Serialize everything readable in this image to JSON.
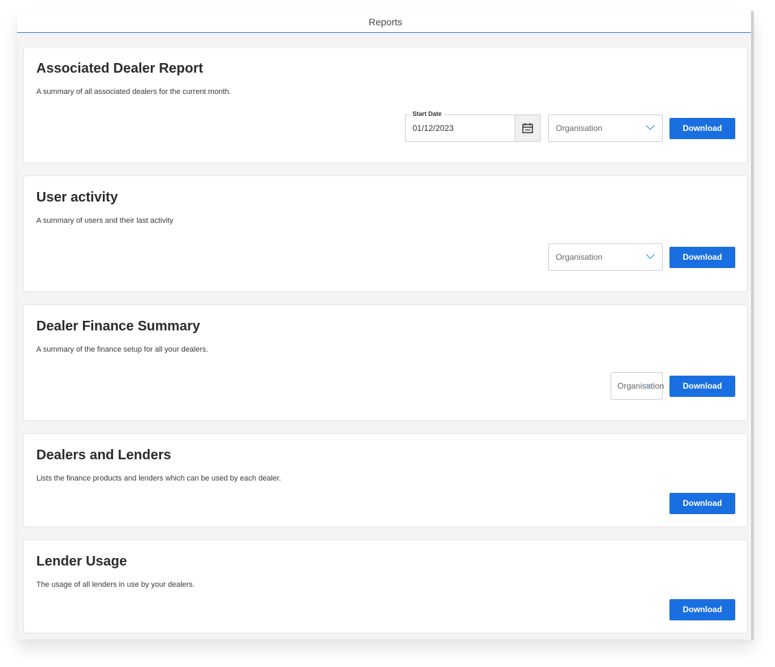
{
  "header": {
    "title": "Reports"
  },
  "reports": [
    {
      "title": "Associated Dealer Report",
      "description": "A summary of all associated dealers for the current month.",
      "start_date_label": "Start Date",
      "start_date_value": "01/12/2023",
      "organisation_placeholder": "Organisation",
      "download_label": "Download"
    },
    {
      "title": "User activity",
      "description": "A summary of users and their last activity",
      "organisation_placeholder": "Organisation",
      "download_label": "Download"
    },
    {
      "title": "Dealer Finance Summary",
      "description": "A summary of the finance setup for all your dealers.",
      "organisation_placeholder": "Organisation",
      "download_label": "Download"
    },
    {
      "title": "Dealers and Lenders",
      "description": "Lists the finance products and lenders which can be used by each dealer.",
      "download_label": "Download"
    },
    {
      "title": "Lender Usage",
      "description": "The usage of all lenders in use by your dealers.",
      "download_label": "Download"
    }
  ],
  "icons": {
    "calendar": "calendar-icon",
    "chevron": "chevron-down-icon"
  },
  "colors": {
    "accent": "#1a6fe0",
    "header_underline": "#3b82d6",
    "background": "#f4f4f4",
    "card": "#ffffff"
  }
}
